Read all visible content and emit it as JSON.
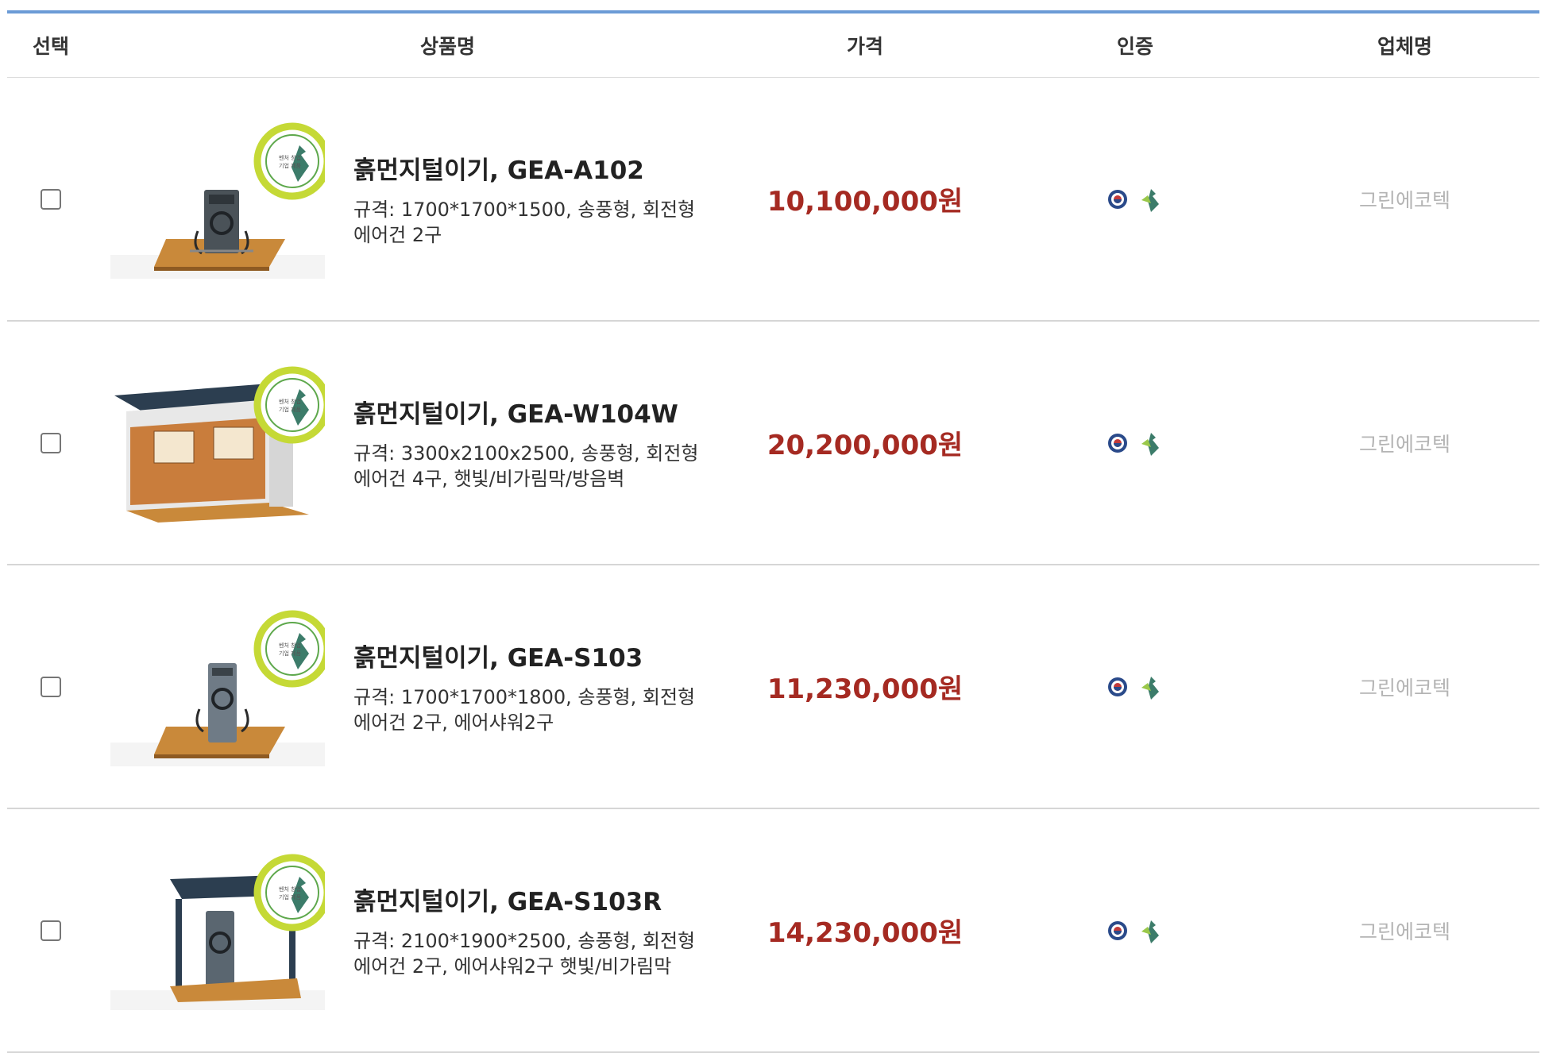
{
  "header": {
    "select": "선택",
    "product": "상품명",
    "price": "가격",
    "cert": "인증",
    "vendor": "업체명"
  },
  "badge_text": "벤처 창업 기업 제품",
  "rows": [
    {
      "name": "흙먼지털이기, GEA-A102",
      "spec_line1": "규격: 1700*1700*1500, 송풍형, 회전형",
      "spec_line2": "에어건 2구",
      "price": "10,100,000원",
      "vendor": "그린에코텍",
      "checked": false,
      "image": "standalone-dust-blower"
    },
    {
      "name": "흙먼지털이기, GEA-W104W",
      "spec_line1": "규격: 3300x2100x2500, 송풍형, 회전형",
      "spec_line2": "에어건 4구, 햇빛/비가림막/방음벽",
      "price": "20,200,000원",
      "vendor": "그린에코텍",
      "checked": false,
      "image": "booth-dust-blower"
    },
    {
      "name": "흙먼지털이기, GEA-S103",
      "spec_line1": "규격: 1700*1700*1800, 송풍형, 회전형",
      "spec_line2": "에어건 2구, 에어샤워2구",
      "price": "11,230,000원",
      "vendor": "그린에코텍",
      "checked": false,
      "image": "standalone-dust-blower-shower"
    },
    {
      "name": "흙먼지털이기, GEA-S103R",
      "spec_line1": "규격: 2100*1900*2500, 송풍형, 회전형",
      "spec_line2": "에어건 2구, 에어샤워2구 햇빛/비가림막",
      "price": "14,230,000원",
      "vendor": "그린에코텍",
      "checked": false,
      "image": "canopy-dust-blower"
    }
  ]
}
